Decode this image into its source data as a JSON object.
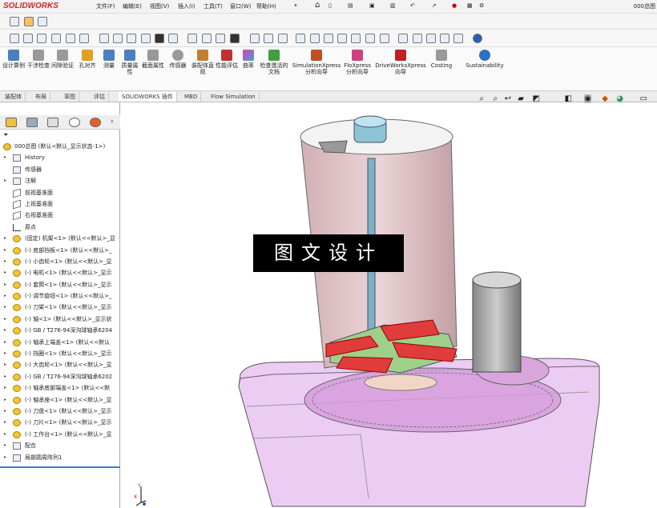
{
  "app": {
    "logo": "SOLIDWORKS",
    "doc_title": "000总图"
  },
  "menu": [
    "文件(F)",
    "编辑(E)",
    "视图(V)",
    "插入(I)",
    "工具(T)",
    "窗口(W)",
    "帮助(H)"
  ],
  "commands": [
    {
      "label": "设计算例",
      "icon": "design-study-icon",
      "color": "#4a7fc1"
    },
    {
      "label": "干涉检查",
      "icon": "interference-icon",
      "color": "#888"
    },
    {
      "label": "间隙验证",
      "icon": "clearance-icon",
      "color": "#888"
    },
    {
      "label": "孔对齐",
      "icon": "hole-align-icon",
      "color": "#e0a020"
    },
    {
      "label": "测量",
      "icon": "measure-icon",
      "color": "#4a7fc1"
    },
    {
      "label": "质量属性",
      "icon": "mass-props-icon",
      "color": "#4a7fc1"
    },
    {
      "label": "截面属性",
      "icon": "section-props-icon",
      "color": "#888"
    },
    {
      "label": "传感器",
      "icon": "sensor-icon",
      "color": "#888"
    },
    {
      "label": "装配体直观",
      "icon": "visualize-icon",
      "color": "#c08030"
    },
    {
      "label": "性能评估",
      "icon": "performance-icon",
      "color": "#c03030"
    },
    {
      "label": "曲率",
      "icon": "curvature-icon",
      "color": "#e040a0"
    },
    {
      "label": "检查激活的文档",
      "icon": "check-doc-icon",
      "color": "#40a040"
    },
    {
      "label": "SimulationXpress 分析向导",
      "icon": "simxpress-icon",
      "color": "#c05020"
    },
    {
      "label": "FloXpress 分析向导",
      "icon": "floxpress-icon",
      "color": "#d04080"
    },
    {
      "label": "DriveWorksXpress 向导",
      "icon": "driveworks-icon",
      "color": "#c02020"
    },
    {
      "label": "Costing",
      "icon": "costing-icon",
      "color": "#888"
    },
    {
      "label": "Sustainability",
      "icon": "sustainability-icon",
      "color": "#3070c0"
    }
  ],
  "tabs": [
    "装配体",
    "布局",
    "草图",
    "评估",
    "SOLIDWORKS 插件",
    "MBD",
    "Flow Simulation"
  ],
  "tree": {
    "root": "000总图 (默认<默认_显示状态-1>)",
    "items": [
      {
        "label": "History",
        "icon": "history-icon",
        "exp": true
      },
      {
        "label": "传感器",
        "icon": "sensor-icon",
        "exp": false
      },
      {
        "label": "注解",
        "icon": "annotation-icon",
        "exp": true
      },
      {
        "label": "前视基准面",
        "icon": "plane-icon",
        "exp": false
      },
      {
        "label": "上视基准面",
        "icon": "plane-icon",
        "exp": false
      },
      {
        "label": "右视基准面",
        "icon": "plane-icon",
        "exp": false
      },
      {
        "label": "原点",
        "icon": "origin-icon",
        "exp": false
      },
      {
        "label": "(固定) 机架<1> (默认<<默认>_显",
        "icon": "part-icon",
        "exp": true
      },
      {
        "label": "(-) 底部挡板<1> (默认<<默认>_",
        "icon": "part-icon",
        "exp": true
      },
      {
        "label": "(-) 小齿轮<1> (默认<<默认>_显",
        "icon": "part-icon",
        "exp": true
      },
      {
        "label": "(-) 电机<1> (默认<<默认>_显示",
        "icon": "part-icon",
        "exp": true
      },
      {
        "label": "(-) 套筒<1> (默认<<默认>_显示",
        "icon": "part-icon",
        "exp": true
      },
      {
        "label": "(-) 调节旋钮<1> (默认<<默认>_",
        "icon": "part-icon",
        "exp": true
      },
      {
        "label": "(-) 刀架<1> (默认<<默认>_显示",
        "icon": "part-icon",
        "exp": true
      },
      {
        "label": "(-) 轴<1> (默认<<默认>_显示状",
        "icon": "part-icon",
        "exp": true
      },
      {
        "label": "(-) GB / T276-94深沟球轴承6204",
        "icon": "part-icon",
        "exp": true
      },
      {
        "label": "(-) 轴承上端盖<1> (默认<<默认",
        "icon": "part-icon",
        "exp": true
      },
      {
        "label": "(-) 挡圈<1> (默认<<默认>_显示",
        "icon": "part-icon",
        "exp": true
      },
      {
        "label": "(-) 大齿轮<1> (默认<<默认>_显",
        "icon": "part-icon",
        "exp": true
      },
      {
        "label": "(-) GB / T276-94深沟球轴承6202",
        "icon": "part-icon",
        "exp": true
      },
      {
        "label": "(-) 轴承底部端盖<1> (默认<<默",
        "icon": "part-icon",
        "exp": true
      },
      {
        "label": "(-) 轴承座<1> (默认<<默认>_显",
        "icon": "part-icon",
        "exp": true
      },
      {
        "label": "(-) 刀盘<1> (默认<<默认>_显示",
        "icon": "part-icon",
        "exp": true
      },
      {
        "label": "(-) 刀片<1> (默认<<默认>_显示",
        "icon": "part-icon",
        "exp": true
      },
      {
        "label": "(-) 工作台<1> (默认<<默认>_显",
        "icon": "part-icon",
        "exp": true
      },
      {
        "label": "配合",
        "icon": "mates-icon",
        "exp": true
      },
      {
        "label": "局部圆周阵列1",
        "icon": "pattern-icon",
        "exp": true
      }
    ]
  },
  "watermark": "图文设计",
  "axis": {
    "x": "X",
    "y": "Y"
  }
}
